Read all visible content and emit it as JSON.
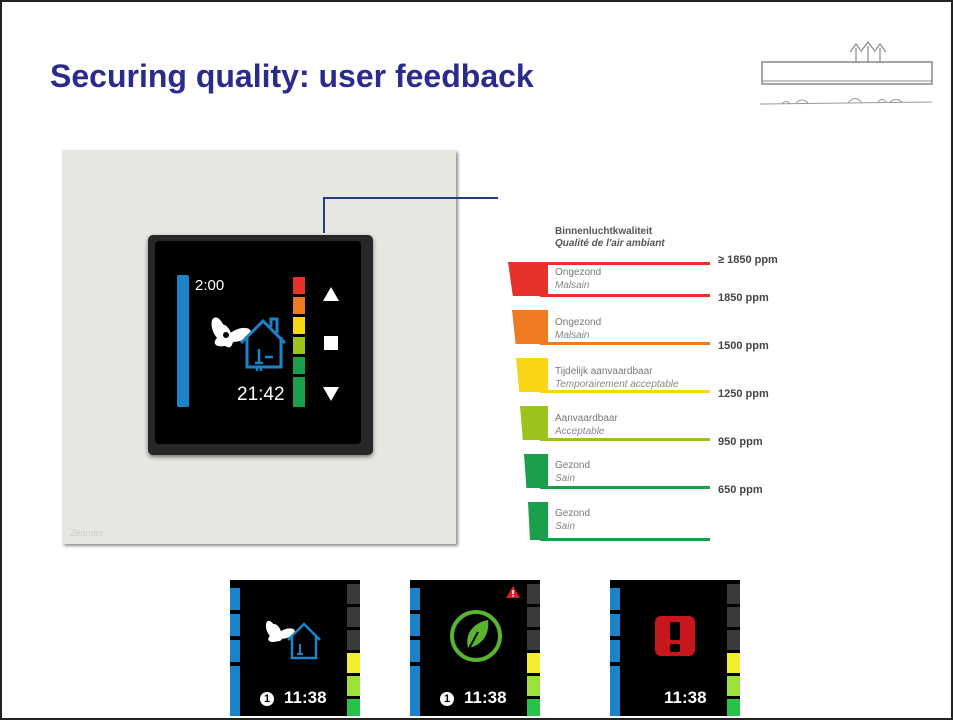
{
  "slide": {
    "title": "Securing quality: user feedback"
  },
  "photo": {
    "credit": "Zehnder"
  },
  "device": {
    "timer": "2:00",
    "clock": "21:42",
    "icons": [
      "fan-icon",
      "house-icon",
      "plug-icon",
      "arrow-up-icon",
      "stop-square-icon",
      "arrow-down-icon"
    ]
  },
  "legend": {
    "heading_nl": "Binnenluchtkwaliteit",
    "heading_fr": "Qualité de l'air ambiant",
    "top_threshold": "≥ 1850 ppm",
    "bands": [
      {
        "nl": "Ongezond",
        "fr": "Malsain",
        "ppm": "1850 ppm",
        "color": "#e63228"
      },
      {
        "nl": "Ongezond",
        "fr": "Malsain",
        "ppm": "1500 ppm",
        "color": "#ee7a22"
      },
      {
        "nl": "Tijdelijk aanvaardbaar",
        "fr": "Temporairement acceptable",
        "ppm": "1250 ppm",
        "color": "#f8d616"
      },
      {
        "nl": "Aanvaardbaar",
        "fr": "Acceptable",
        "ppm": "950 ppm",
        "color": "#9bc31c"
      },
      {
        "nl": "Gezond",
        "fr": "Sain",
        "ppm": "650 ppm",
        "color": "#1aa04a"
      },
      {
        "nl": "Gezond",
        "fr": "Sain",
        "ppm": "",
        "color": "#1aa04a"
      }
    ]
  },
  "mini_screens": [
    {
      "time": "11:38",
      "info": "1",
      "icon": "fan-house-icon"
    },
    {
      "time": "11:38",
      "info": "1",
      "icon": "eco-leaf-plug-icon"
    },
    {
      "time": "11:38",
      "info": "",
      "icon": "alert-exclamation-icon"
    }
  ],
  "colors": {
    "title": "#2b2b8c",
    "screen_blue": "#1b83c8",
    "alert_red": "#c8161d"
  }
}
